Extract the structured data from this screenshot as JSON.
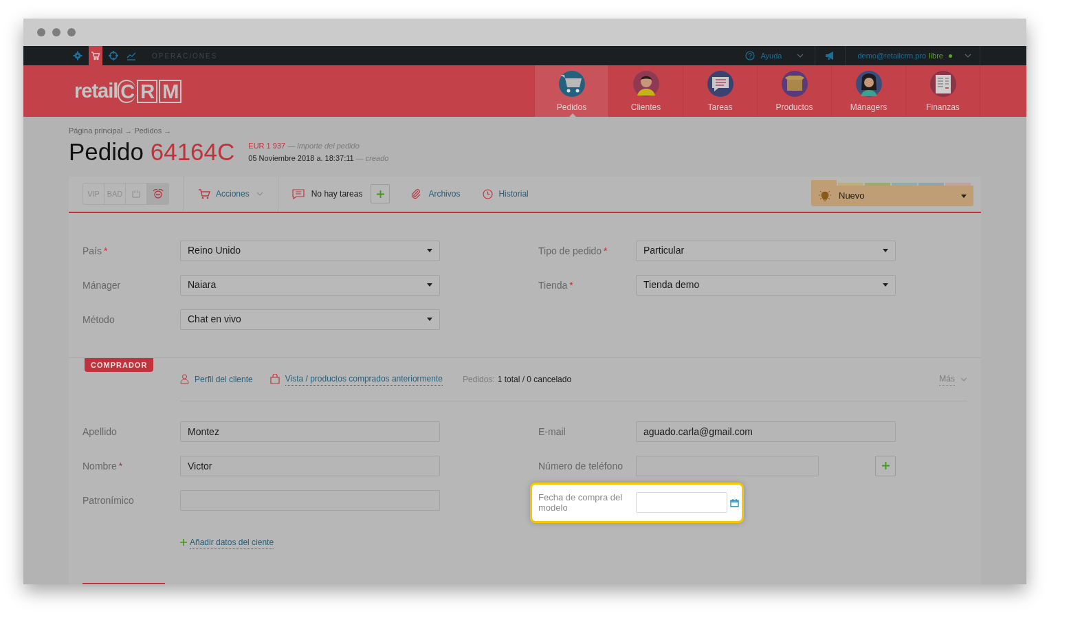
{
  "topbar": {
    "modules": [
      {
        "selected": false
      },
      {
        "selected": true
      },
      {
        "selected": false
      },
      {
        "selected": false
      }
    ],
    "section": "OPERACIONES",
    "help": "Ayuda",
    "user": "demo@retailcrm.pro",
    "plan": "libre"
  },
  "logo": {
    "word": "retail",
    "letters": [
      "C",
      "R",
      "M"
    ]
  },
  "nav": [
    {
      "label": "Pedidos",
      "selected": true
    },
    {
      "label": "Clientes",
      "selected": false
    },
    {
      "label": "Tareas",
      "selected": false
    },
    {
      "label": "Productos",
      "selected": false
    },
    {
      "label": "Mánagers",
      "selected": false
    },
    {
      "label": "Finanzas",
      "selected": false
    }
  ],
  "breadcrumb": "Página principal → Pedidos →",
  "order": {
    "title": "Pedido",
    "number": "64164C",
    "amount": "EUR 1 937",
    "amount_note": "— importe del pedido",
    "date": "05 Noviembre 2018 a. 18:37:11",
    "date_note": "— creado"
  },
  "toolbar": {
    "flags": [
      {
        "kind": "text",
        "label": "VIP",
        "selected": false
      },
      {
        "kind": "text",
        "label": "BAD",
        "selected": false
      },
      {
        "kind": "icon",
        "selected": false
      },
      {
        "kind": "icon",
        "selected": true
      }
    ],
    "actions": "Acciones",
    "tasks": "No hay tareas",
    "files": "Archivos",
    "history": "Historial"
  },
  "status": {
    "label": "Nuevo",
    "groups": [
      {
        "color": "#bf9e76",
        "selected": true
      },
      {
        "color": "#b8b07a",
        "selected": false
      },
      {
        "color": "#9aaa72",
        "selected": false
      },
      {
        "color": "#8eaca8",
        "selected": false
      },
      {
        "color": "#93a3ab",
        "selected": false
      },
      {
        "color": "#bda1a4",
        "selected": false
      }
    ]
  },
  "order_fields": [
    {
      "label": "País",
      "required_mark": "*",
      "value": "Reino Unido"
    },
    {
      "label": "Tipo de pedido",
      "required_mark": "*",
      "value": "Particular"
    },
    {
      "label": "Mánager",
      "value": "Naiara"
    },
    {
      "label": "Tienda",
      "required_mark": "*",
      "value": "Tienda demo"
    },
    {
      "label": "Método",
      "value": "Chat en vivo"
    }
  ],
  "buyer": {
    "badge": "COMPRADOR",
    "profile_link": "Perfil del cliente",
    "history_link": "Vista / productos comprados anteriormente",
    "orders_label": "Pedidos:",
    "orders_value": "1 total / 0 cancelado",
    "more": "Más",
    "left_fields": [
      {
        "label": "Apellido",
        "value": "Montez"
      },
      {
        "label": "Nombre",
        "required_mark": "*",
        "value": "Victor"
      },
      {
        "label": "Patronímico"
      }
    ],
    "email": {
      "label": "E-mail",
      "value": "aguado.carla@gmail.com"
    },
    "phone": {
      "label": "Número de teléfono"
    },
    "highlight": {
      "label": "Fecha de compra del modelo"
    },
    "add_link": "Añadir datos del ciente"
  }
}
